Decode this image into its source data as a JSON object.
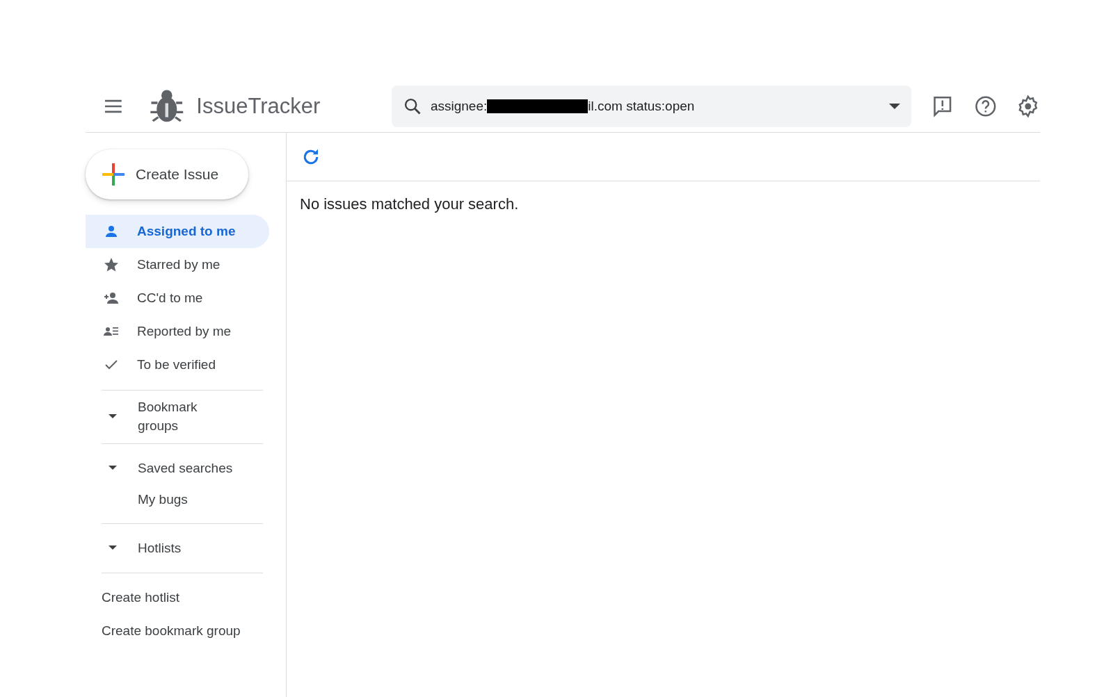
{
  "header": {
    "title": "IssueTracker",
    "search": {
      "value_start": "assignee:",
      "value_end": "il.com status:open"
    }
  },
  "sidebar": {
    "create_button": "Create Issue",
    "nav": [
      {
        "label": "Assigned to me",
        "selected": true
      },
      {
        "label": "Starred by me",
        "selected": false
      },
      {
        "label": "CC'd to me",
        "selected": false
      },
      {
        "label": "Reported by me",
        "selected": false
      },
      {
        "label": "To be verified",
        "selected": false
      }
    ],
    "sections": [
      {
        "title": "Bookmark groups",
        "expanded": true
      },
      {
        "title": "Saved searches",
        "expanded": true,
        "items": [
          "My bugs"
        ]
      },
      {
        "title": "Hotlists",
        "expanded": true
      }
    ],
    "links": [
      "Create hotlist",
      "Create bookmark group"
    ]
  },
  "main": {
    "message": "No issues matched your search."
  }
}
